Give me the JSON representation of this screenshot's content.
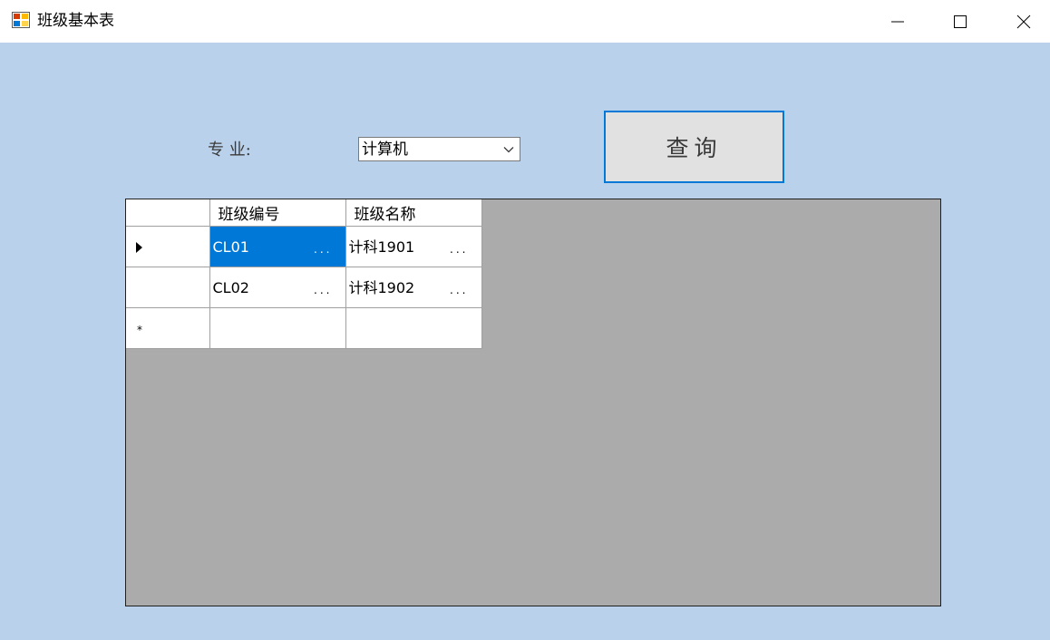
{
  "window": {
    "title": "班级基本表",
    "controls": {
      "minimize": "minimize-icon",
      "maximize": "maximize-icon",
      "close": "close-icon"
    }
  },
  "form": {
    "major_label": "专  业:",
    "major_select_value": "计算机",
    "query_button_label": "查询"
  },
  "grid": {
    "columns": [
      "班级编号",
      "班级名称"
    ],
    "rows": [
      {
        "marker": "current-row-arrow",
        "cells": [
          "CL01",
          "计科1901"
        ],
        "selected_cell": 0
      },
      {
        "marker": "",
        "cells": [
          "CL02",
          "计科1902"
        ]
      }
    ],
    "new_row_marker": "*",
    "cell_ellipsis": "..."
  },
  "colors": {
    "client_background": "#bad1eb",
    "grid_background": "#ababab",
    "selection": "#0078d7",
    "button_border": "#0078d7",
    "button_face": "#e1e1e1"
  }
}
